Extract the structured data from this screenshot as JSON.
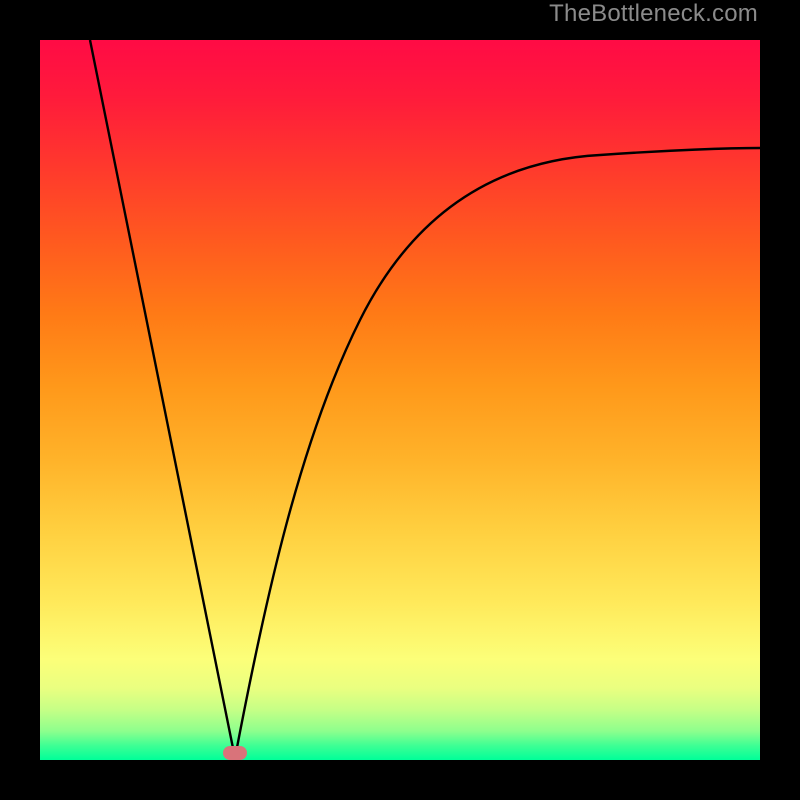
{
  "watermark": "TheBottleneck.com",
  "colors": {
    "background": "#000000",
    "gradient_top": "#ff0b45",
    "gradient_bottom": "#00ff99",
    "curve": "#000000",
    "marker": "#d9737a",
    "watermark": "#8b8b8b"
  },
  "chart_data": {
    "type": "line",
    "title": "",
    "xlabel": "",
    "ylabel": "",
    "xlim": [
      0,
      100
    ],
    "ylim": [
      0,
      100
    ],
    "grid": false,
    "series": [
      {
        "name": "left-branch",
        "x": [
          7,
          10,
          13,
          16,
          19,
          22,
          25,
          27
        ],
        "values": [
          100,
          85,
          70,
          55,
          40,
          25,
          10,
          0
        ]
      },
      {
        "name": "right-branch",
        "x": [
          27,
          30,
          33,
          37,
          42,
          48,
          55,
          63,
          72,
          82,
          92,
          100
        ],
        "values": [
          0,
          15,
          29,
          42,
          53,
          62,
          69,
          74,
          78,
          81,
          83,
          85
        ]
      }
    ],
    "marker": {
      "x": 27,
      "y": 0
    },
    "annotations": []
  }
}
